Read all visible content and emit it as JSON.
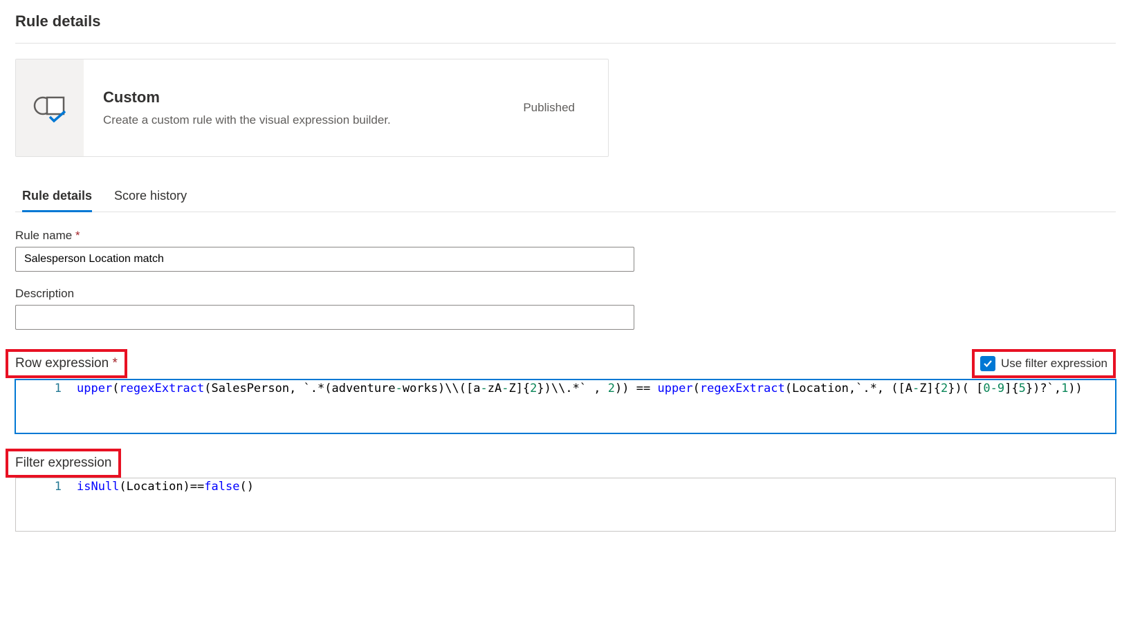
{
  "pageTitle": "Rule details",
  "card": {
    "title": "Custom",
    "desc": "Create a custom rule with the visual expression builder.",
    "status": "Published"
  },
  "tabs": [
    {
      "label": "Rule details",
      "active": true
    },
    {
      "label": "Score history",
      "active": false
    }
  ],
  "ruleName": {
    "label": "Rule name",
    "value": "Salesperson Location match"
  },
  "description": {
    "label": "Description",
    "value": ""
  },
  "rowExpr": {
    "label": "Row expression",
    "checkboxLabel": "Use filter expression",
    "lineNo": "1",
    "tokens": {
      "fn1": "upper",
      "p1": "(",
      "fn2": "regexExtract",
      "p2": "(",
      "arg1": "SalesPerson, `.*(adventure",
      "dash1": "-",
      "arg1b": "works)\\\\([a",
      "dash2": "-",
      "arg1c": "zA",
      "dash3": "-",
      "arg1d": "Z]{",
      "lit2": "2",
      "arg1e": "})\\\\.*` , ",
      "lit2b": "2",
      "p3": "))",
      " eq": " == ",
      "fn3": "upper",
      "p4": "(",
      "fn4": "regexExtract",
      "p5": "(",
      "arg2": "Location,`.*, ([A",
      "dash4": "-",
      "arg2b": "Z]{",
      "lit2c": "2",
      "arg2c": "})( [",
      "lit0": "0",
      "dash5": "-",
      "lit9": "9",
      "arg2d": "]{",
      "lit5": "5",
      "arg2e": "})?`,",
      "lit1": "1",
      "p6": "))"
    }
  },
  "filterExpr": {
    "label": "Filter expression",
    "lineNo": "1",
    "tokens": {
      "fn1": "isNull",
      "p1": "(",
      "arg": "Location)",
      "eq": "==",
      "kw": "false",
      "p2": "()"
    }
  }
}
